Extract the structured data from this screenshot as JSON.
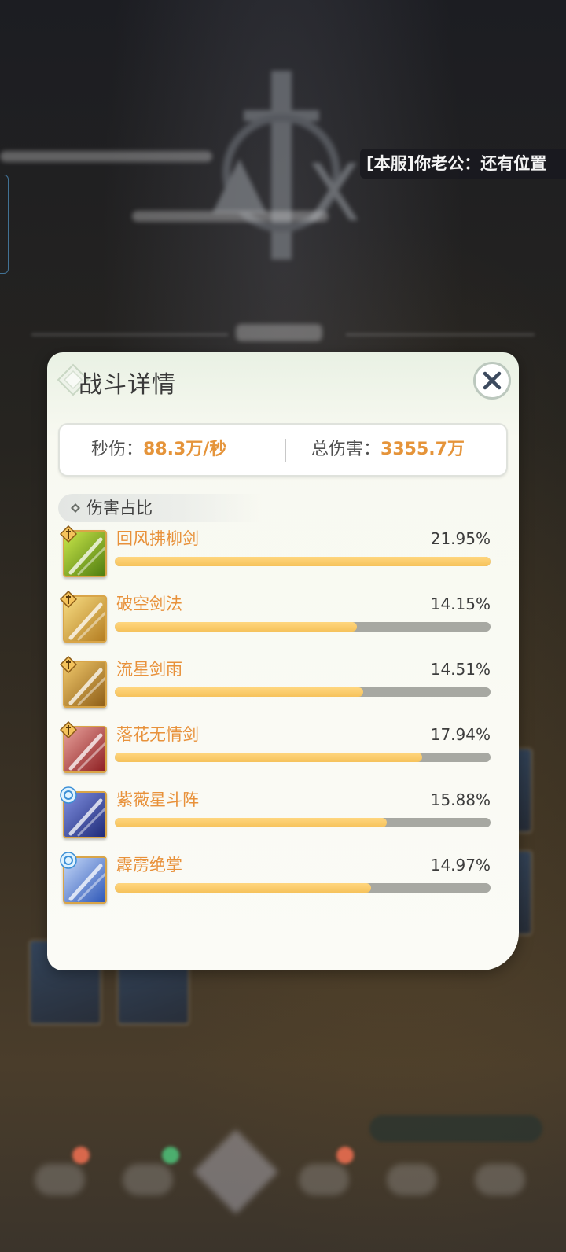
{
  "chat": {
    "message": "[本服]你老公：还有位置"
  },
  "dialog": {
    "title": "战斗详情",
    "close_icon": "close-icon",
    "stats": {
      "dps_label": "秒伤：",
      "dps_value": "88.3万/秒",
      "total_label": "总伤害：",
      "total_value": "3355.7万"
    },
    "section_title": "伤害占比",
    "skills": [
      {
        "name": "回风拂柳剑",
        "percent_text": "21.95%",
        "fill": 1.0,
        "icon": "wind-sword-skill-icon",
        "badge": "sword-badge-icon",
        "colors": [
          "#c9e64a",
          "#4f7d0f"
        ]
      },
      {
        "name": "破空剑法",
        "percent_text": "14.15%",
        "fill": 0.645,
        "icon": "sky-piercing-sword-skill-icon",
        "badge": "sword-badge-icon",
        "colors": [
          "#f7dc82",
          "#b47d21"
        ]
      },
      {
        "name": "流星剑雨",
        "percent_text": "14.51%",
        "fill": 0.661,
        "icon": "meteor-sword-rain-skill-icon",
        "badge": "sword-badge-icon",
        "colors": [
          "#efc76a",
          "#8f5e17"
        ]
      },
      {
        "name": "落花无情剑",
        "percent_text": "17.94%",
        "fill": 0.817,
        "icon": "falling-flower-sword-skill-icon",
        "badge": "sword-badge-icon",
        "colors": [
          "#e7a09a",
          "#8e1f22"
        ]
      },
      {
        "name": "紫薇星斗阵",
        "percent_text": "15.88%",
        "fill": 0.723,
        "icon": "star-formation-skill-icon",
        "badge": "spirit-badge-icon",
        "colors": [
          "#7f8fe0",
          "#1f2a78"
        ]
      },
      {
        "name": "霹雳绝掌",
        "percent_text": "14.97%",
        "fill": 0.682,
        "icon": "thunder-palm-skill-icon",
        "badge": "spirit-badge-icon",
        "colors": [
          "#c3d7f8",
          "#2f58b8"
        ]
      }
    ]
  },
  "colors": {
    "accent_orange": "#e5943a",
    "bar_fill": "#f6c25b",
    "bar_track": "#a7a8a2"
  }
}
